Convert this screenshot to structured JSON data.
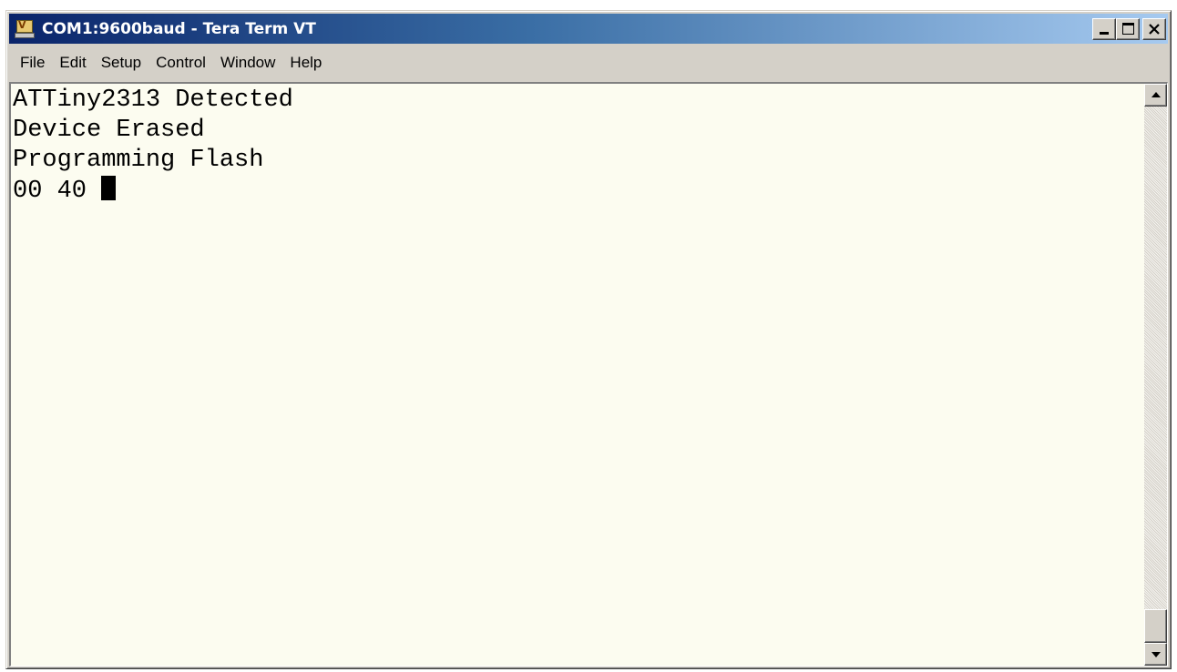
{
  "window": {
    "title": "COM1:9600baud - Tera Term VT",
    "icon": "tera-term-icon"
  },
  "caption_buttons": {
    "minimize_icon": "minimize-icon",
    "maximize_icon": "maximize-icon",
    "close_icon": "close-icon"
  },
  "menu": {
    "items": [
      "File",
      "Edit",
      "Setup",
      "Control",
      "Window",
      "Help"
    ]
  },
  "terminal": {
    "lines": [
      "ATTiny2313 Detected",
      "Device Erased",
      "Programming Flash",
      "00 40 "
    ],
    "background_color": "#fcfcf0",
    "text_color": "#000000"
  },
  "scrollbar": {
    "up_icon": "arrow-up-icon",
    "down_icon": "arrow-down-icon"
  },
  "colors": {
    "titlebar_start": "#0a246a",
    "titlebar_end": "#a6caf0",
    "chrome": "#d4d0c8"
  }
}
